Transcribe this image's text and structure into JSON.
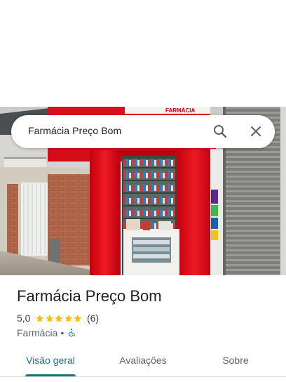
{
  "search": {
    "query": "Farmácia Preço Bom"
  },
  "place": {
    "name": "Farmácia Preço Bom",
    "rating": "5,0",
    "stars": 5,
    "review_count": "(6)",
    "category": "Farmácia",
    "separator": "•"
  },
  "photo": {
    "sign_text": "FARMÁCIA"
  },
  "tabs": [
    {
      "label": "Visão geral",
      "active": true
    },
    {
      "label": "Avaliações",
      "active": false
    },
    {
      "label": "Sobre",
      "active": false
    }
  ],
  "colors": {
    "accent": "#1a737e",
    "star": "#fbbc04",
    "accessibility_icon": "#1a73e8",
    "storefront_red": "#e00a16"
  }
}
